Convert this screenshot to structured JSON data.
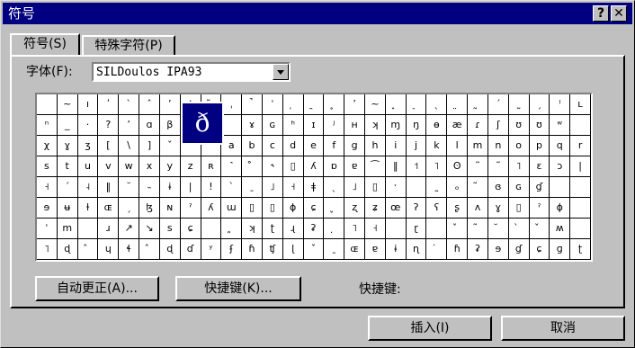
{
  "window": {
    "title": "符号"
  },
  "titlebar": {
    "help_label": "?",
    "close_label": "✕"
  },
  "tabs": [
    {
      "label": "符号(S)"
    },
    {
      "label": "特殊字符(P)"
    }
  ],
  "font": {
    "label": "字体(F):",
    "value": "SILDoulos IPA93"
  },
  "symbols": {
    "preview": "ð",
    "rows": [
      [
        "",
        "~",
        "ı",
        "ʹ",
        "ˋ",
        "ˆ",
        "ʼ",
        "ʻ",
        "̃",
        "ˌ",
        "̚",
        "ˈ",
        "̩",
        "̯",
        "̥",
        "ʼ",
        "~",
        "̟",
        "̠",
        "ˎ",
        "̤",
        "̰",
        "ˊ",
        "˷",
        "ˏ",
        "ˡ",
        "ʟ"
      ],
      [
        "ⁿ",
        "_",
        "·",
        "?",
        "ʼ",
        "ɑ",
        "β",
        "",
        "",
        "",
        "ɤ",
        "ɢ",
        "ʰ",
        "ɪ",
        "ʲ",
        "ʜ",
        "ʞ",
        "ɱ",
        "ŋ",
        "ɵ",
        "æ",
        "ɾ",
        "ʃ",
        "ʊ",
        "ʊ",
        "ʷ",
        ""
      ],
      [
        "χ",
        "ɣ",
        "ʒ",
        "[",
        "\\",
        "]",
        "ˇ",
        "",
        "",
        "a",
        "b",
        "c",
        "d",
        "e",
        "f",
        "g",
        "h",
        "i",
        "j",
        "k",
        "l",
        "m",
        "n",
        "o",
        "p",
        "q",
        "r"
      ],
      [
        "s",
        "t",
        "u",
        "v",
        "w",
        "x",
        "y",
        "z",
        "ʀ",
        "˺",
        "̊",
        "˞",
        "▯",
        "ʎ",
        "ɒ",
        "ɐ",
        "⁀",
        "‖",
        "˦",
        "˥",
        "ʘ",
        "˜",
        "˜",
        "˥",
        "ɛ",
        "ɔ",
        "|"
      ],
      [
        "˧",
        "ˊ",
        "˨",
        "‖",
        "˘",
        "˵",
        "ɨ",
        "|",
        "!",
        "ˋ",
        "ˍ",
        "˩",
        "˧",
        "ǂ",
        "ˎ",
        "˩",
        "▯",
        "ˑ",
        "",
        "˷",
        "ₒ",
        "̃",
        "ɞ",
        "ɢ",
        "ɠ",
        "",
        ""
      ],
      [
        "ɘ",
        "ʉ",
        "ɫ",
        "ɶ",
        "ˏ",
        "ɮ",
        "ɴ",
        "ˀ",
        "ʎ",
        "ɯ",
        "▯",
        "▯",
        "ɸ",
        "ɕ",
        "̬",
        "ʐ",
        "ʑ",
        "œ",
        "ʔ",
        "ʕ",
        "ʂ",
        "ʌ",
        "ɣ",
        "▯",
        "ˀ",
        "ɸ",
        ""
      ],
      [
        "ˈ",
        "m",
        "",
        "ɹ",
        "↗",
        "↘",
        "s",
        "ɕ",
        "",
        "̪",
        "ʞ",
        "ʈ",
        "ɻ",
        "ʡ",
        "̣",
        "˥",
        "˧",
        "",
        "ɽ",
        "",
        "̌",
        "̃",
        "̆",
        "̀",
        "̌",
        "ʍ",
        ""
      ],
      [
        "˥",
        "ɖ",
        "̂",
        "ɥ",
        "ɬ",
        "̂",
        "ɖ",
        "ɗ",
        "ʸ",
        "ʄ",
        "ɦ",
        "ʧ",
        "ɭ",
        "ˇ",
        "ˍ",
        "ɶ",
        "ɐ",
        "ɨ",
        "ɳ",
        "̇",
        "ɦ",
        "ʡ",
        "ɘ",
        "ɠ",
        "ɕ",
        "ɡ",
        "ʈ"
      ]
    ]
  },
  "buttons": {
    "autocorrect": "自动更正(A)...",
    "shortcut": "快捷键(K)...",
    "insert": "插入(I)",
    "cancel": "取消"
  },
  "shortcut_label": "快捷键:"
}
